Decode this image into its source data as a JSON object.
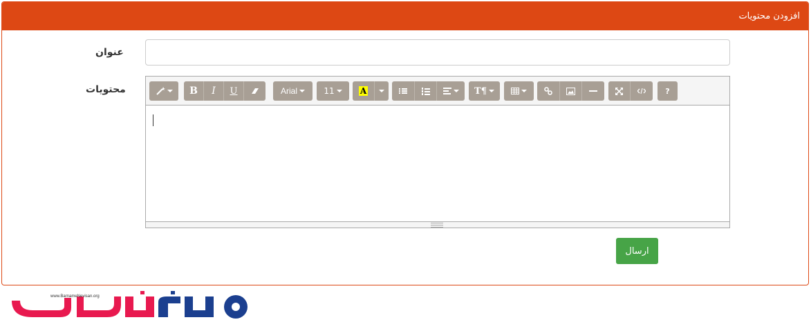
{
  "panel": {
    "heading": "افزودن محتویات"
  },
  "form": {
    "title_label": "عنوان",
    "content_label": "محتویات",
    "title_value": "",
    "submit_label": "ارسال"
  },
  "toolbar": {
    "bold": "B",
    "italic": "I",
    "underline": "U",
    "font_name": "Arial",
    "font_size": "11",
    "color_letter": "A",
    "style_label": "T¶",
    "help": "?"
  },
  "logo": {
    "url_text": "www.BarnameNevisan.org"
  },
  "colors": {
    "header": "#dd4814",
    "toolbar_button": "#a89f95",
    "submit": "#47a447"
  }
}
